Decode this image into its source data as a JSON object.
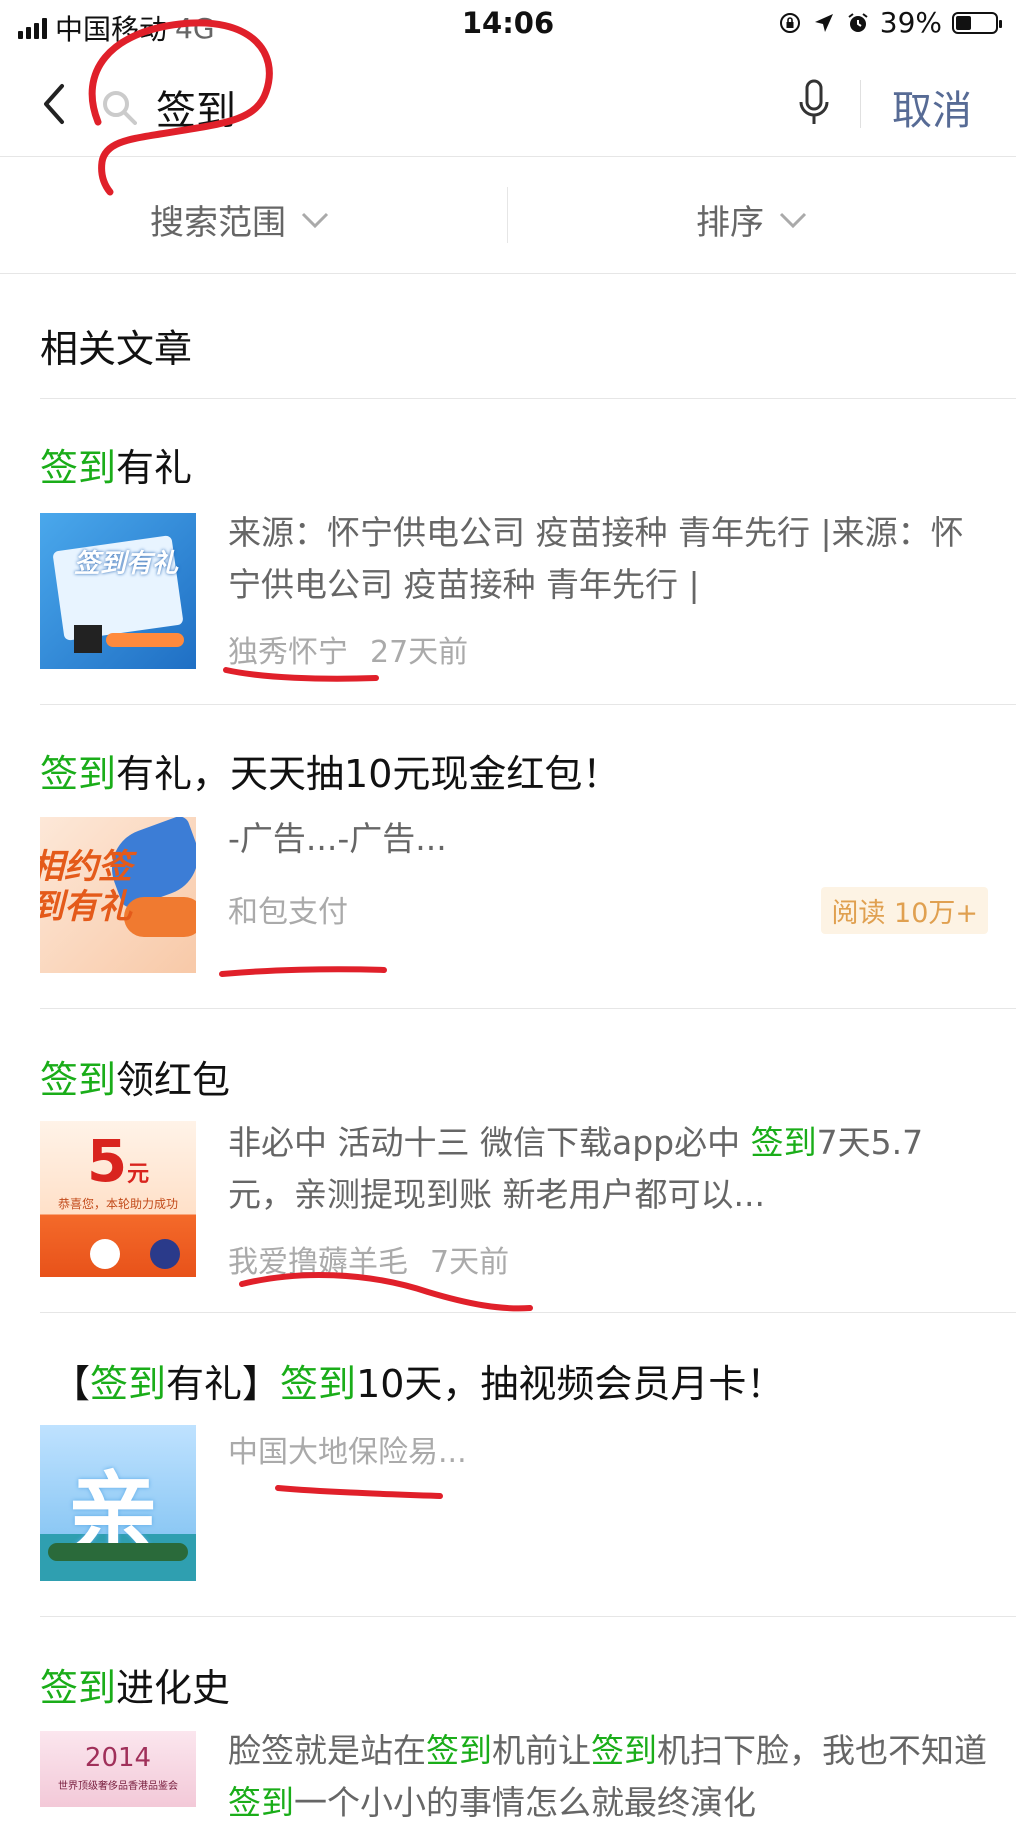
{
  "status_bar": {
    "carrier": "中国移动",
    "network": "4G",
    "time": "14:06",
    "battery": "39%",
    "battery_level": 0.39
  },
  "search": {
    "query": "签到",
    "cancel_label": "取消"
  },
  "filters": {
    "scope_label": "搜索范围",
    "sort_label": "排序"
  },
  "section": {
    "title": "相关文章"
  },
  "articles": [
    {
      "title_highlight": "签到",
      "title_rest": "有礼",
      "snippet": "来源：怀宁供电公司 疫苗接种 青年先行 |来源：怀宁供电公司 疫苗接种 青年先行 |",
      "source": "独秀怀宁",
      "time": "27天前"
    },
    {
      "title_highlight": "签到",
      "title_rest": "有礼，天天抽10元现金红包！",
      "snippet": "-广告...-广告...",
      "source": "和包支付",
      "read_label": "阅读 10万+"
    },
    {
      "title_highlight": "签到",
      "title_rest": "领红包",
      "snippet_pre": "非必中 活动十三 微信下载app必中 ",
      "snippet_hl": "签到",
      "snippet_post": "7天5.7元，亲测提现到账 新老用户都可以...",
      "source": "我爱撸薅羊毛",
      "time": "7天前"
    },
    {
      "title_pre": "【",
      "title_hl1": "签到",
      "title_mid": "有礼】",
      "title_hl2": "签到",
      "title_post": "10天，抽视频会员月卡！",
      "source": "中国大地保险易..."
    },
    {
      "title_highlight": "签到",
      "title_rest": "进化史",
      "snippet_p1": "脸签就是站在",
      "snippet_h1": "签到",
      "snippet_p2": "机前让",
      "snippet_h2": "签到",
      "snippet_p3": "机扫下脸，我也不知道",
      "snippet_h3": "签到",
      "snippet_p4": "一个小小的事情怎么就最终演化"
    }
  ],
  "thumbnails": {
    "t1_text": "签到有礼",
    "t2_text": "相约签到有礼",
    "t3_amount": "5",
    "t3_unit": "元",
    "t3_caption": "恭喜您，本轮助力成功",
    "t4_char": "亲",
    "t5_year": "2014",
    "t5_caption": "世界顶级奢侈品香港品鉴会"
  },
  "colors": {
    "highlight": "#1aad19",
    "link": "#576b95",
    "annotation": "#e0202a"
  }
}
